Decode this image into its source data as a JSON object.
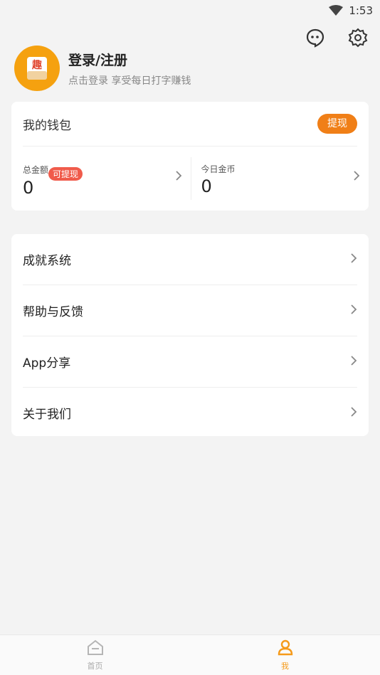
{
  "status_bar": {
    "time": "1:53",
    "wifi_icon": "wifi-icon"
  },
  "header": {
    "message_icon": "message-icon",
    "settings_icon": "settings-gear-icon"
  },
  "profile": {
    "title": "登录/注册",
    "subtitle": "点击登录 享受每日打字赚钱",
    "avatar_char": "趣"
  },
  "wallet": {
    "title": "我的钱包",
    "withdraw_label": "提现",
    "total_label": "总金额",
    "withdrawable_badge": "可提现",
    "total_value": "0",
    "today_label": "今日金币",
    "today_value": "0"
  },
  "menu": {
    "items": [
      {
        "label": "成就系统"
      },
      {
        "label": "帮助与反馈"
      },
      {
        "label": "App分享"
      },
      {
        "label": "关于我们"
      }
    ]
  },
  "tabbar": {
    "home_label": "首页",
    "me_label": "我"
  },
  "colors": {
    "accent": "#f07f17",
    "avatar_bg": "#f5a10f",
    "badge": "#f05b4b"
  }
}
